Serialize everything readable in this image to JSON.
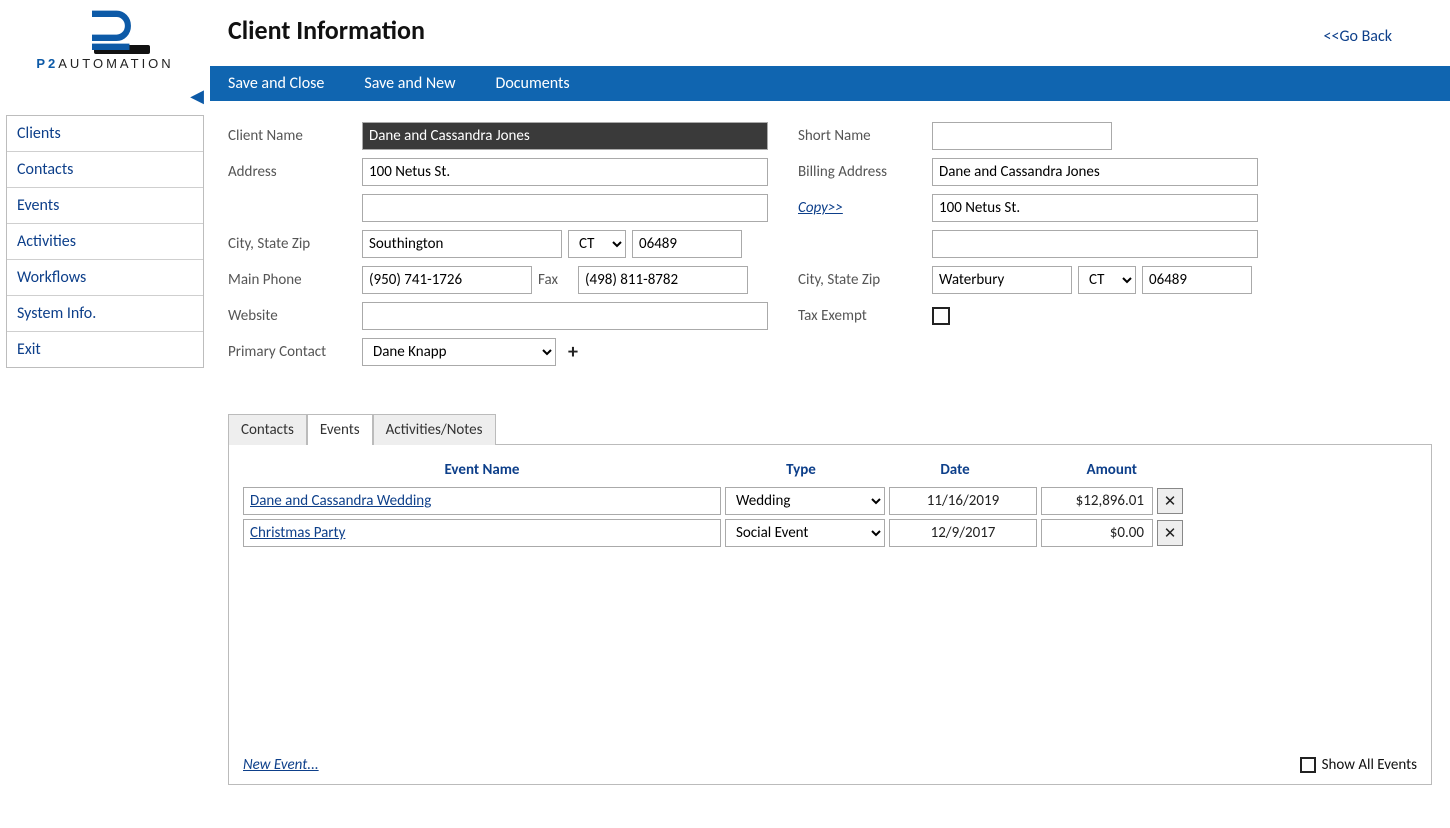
{
  "header": {
    "title": "Client Information",
    "go_back": "<<Go Back"
  },
  "brand": {
    "name": "P2",
    "sub": "AUTOMATION"
  },
  "menubar": [
    "Save and Close",
    "Save and New",
    "Documents"
  ],
  "sidebar": {
    "items": [
      "Clients",
      "Contacts",
      "Events",
      "Activities",
      "Workflows",
      "System Info.",
      "Exit"
    ]
  },
  "labels": {
    "client_name": "Client Name",
    "address": "Address",
    "city_state_zip": "City, State Zip",
    "main_phone": "Main Phone",
    "fax": "Fax",
    "website": "Website",
    "primary_contact": "Primary Contact",
    "short_name": "Short Name",
    "billing_address": "Billing Address",
    "copy": "Copy>>",
    "tax_exempt": "Tax Exempt"
  },
  "form": {
    "client_name": "Dane and Cassandra Jones",
    "address1": "100 Netus St.",
    "address2": "",
    "city": "Southington",
    "state": "CT",
    "zip": "06489",
    "main_phone": "(950) 741-1726",
    "fax": "(498) 811-8782",
    "website": "",
    "primary_contact": "Dane Knapp",
    "short_name": "",
    "billing_name": "Dane and Cassandra Jones",
    "billing_addr1": "100 Netus St.",
    "billing_addr2": "",
    "billing_city": "Waterbury",
    "billing_state": "CT",
    "billing_zip": "06489",
    "tax_exempt": false
  },
  "tabs": {
    "items": [
      "Contacts",
      "Events",
      "Activities/Notes"
    ],
    "active_index": 1
  },
  "events_table": {
    "headers": {
      "name": "Event Name",
      "type": "Type",
      "date": "Date",
      "amount": "Amount"
    },
    "type_options": [
      "Wedding",
      "Social Event"
    ],
    "rows": [
      {
        "name": "Dane and Cassandra Wedding",
        "type": "Wedding",
        "date": "11/16/2019",
        "amount": "$12,896.01"
      },
      {
        "name": "Christmas Party",
        "type": "Social Event",
        "date": "12/9/2017",
        "amount": "$0.00"
      }
    ],
    "new_event": "New Event...",
    "show_all": "Show All Events"
  }
}
